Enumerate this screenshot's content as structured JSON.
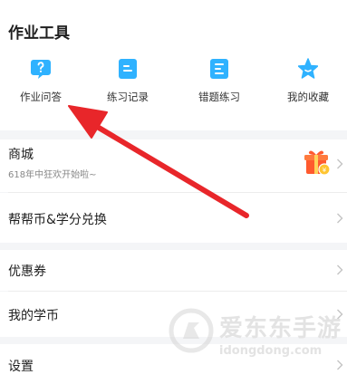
{
  "tools_section": {
    "title": "作业工具",
    "items": [
      {
        "label": "作业问答",
        "icon": "question-bubble-icon"
      },
      {
        "label": "练习记录",
        "icon": "practice-record-icon"
      },
      {
        "label": "错题练习",
        "icon": "wrong-question-icon"
      },
      {
        "label": "我的收藏",
        "icon": "star-favorite-icon"
      }
    ],
    "icon_color": "#2fb2ff"
  },
  "menu": {
    "shop": {
      "label": "商城",
      "subtitle": "618年中狂欢开始啦~",
      "badge_icon": "gift-box-icon"
    },
    "exchange": {
      "label": "帮帮币&学分兑换"
    },
    "coupon": {
      "label": "优惠券"
    },
    "coins": {
      "label": "我的学币"
    },
    "settings": {
      "label": "设置"
    }
  },
  "watermark": {
    "name": "爱东东手游",
    "domain": "idongdong.com"
  },
  "annotation": {
    "arrow_color": "#e8262a"
  }
}
